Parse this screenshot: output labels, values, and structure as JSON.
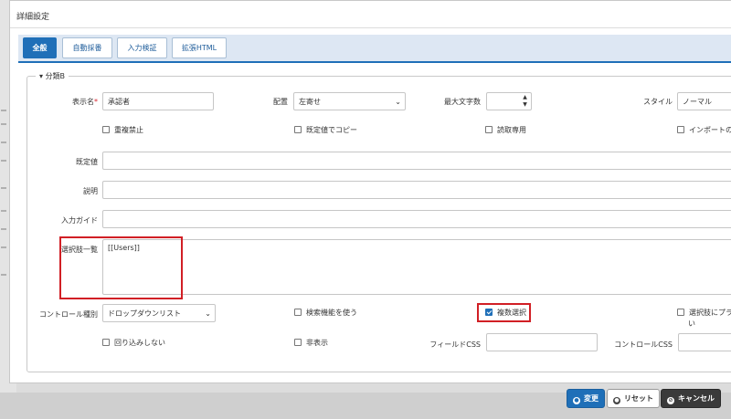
{
  "dialog": {
    "title": "詳細設定"
  },
  "tabs": [
    {
      "label": "全般",
      "active": true
    },
    {
      "label": "自動採番",
      "active": false
    },
    {
      "label": "入力検証",
      "active": false
    },
    {
      "label": "拡張HTML",
      "active": false
    }
  ],
  "section": {
    "label": "分類B",
    "toggle_icon": "caret-down-icon"
  },
  "fields": {
    "display_name": {
      "label": "表示名",
      "required_mark": "*",
      "value": "承認者"
    },
    "alignment": {
      "label": "配置",
      "value": "左寄せ"
    },
    "max_length": {
      "label": "最大文字数",
      "value": ""
    },
    "style": {
      "label": "スタイル",
      "value": "ノーマル"
    },
    "default_value": {
      "label": "既定値",
      "value": ""
    },
    "description": {
      "label": "説明",
      "value": ""
    },
    "input_guide": {
      "label": "入力ガイド",
      "value": ""
    },
    "choices": {
      "label": "選択肢一覧",
      "value": "[[Users]]"
    },
    "control_type": {
      "label": "コントロール種別",
      "value": "ドロップダウンリスト"
    },
    "field_css": {
      "label": "フィールドCSS",
      "value": ""
    },
    "control_css": {
      "label": "コントロールCSS",
      "value": ""
    }
  },
  "checkboxes": {
    "no_duplicate": {
      "label": "重複禁止",
      "checked": false
    },
    "copy_default": {
      "label": "既定値でコピー",
      "checked": false
    },
    "read_only": {
      "label": "読取専用",
      "checked": false
    },
    "import": {
      "label": "インポートの",
      "checked": false
    },
    "search_function": {
      "label": "検索機能を使う",
      "checked": false
    },
    "multi_select": {
      "label": "複数選択",
      "checked": true
    },
    "choice_plain_line1": {
      "label": "選択肢にプラ",
      "checked": false
    },
    "choice_plain_line2": "い",
    "no_wrap": {
      "label": "回り込みしない",
      "checked": false
    },
    "hidden": {
      "label": "非表示",
      "checked": false
    }
  },
  "buttons": {
    "change": "変更",
    "reset": "リセット",
    "cancel": "キャンセル"
  },
  "colors": {
    "accent": "#1f6fb8",
    "highlight": "#d11f25"
  }
}
